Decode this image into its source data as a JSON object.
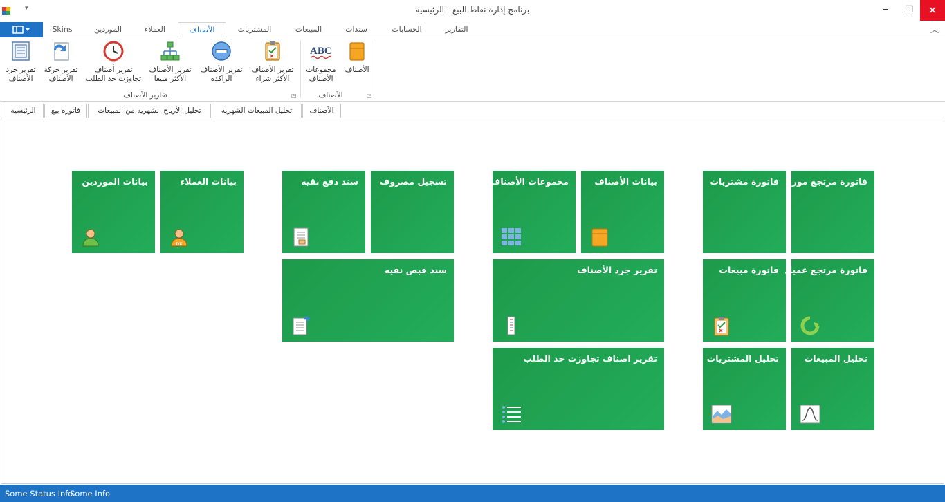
{
  "window": {
    "title": "برنامج إدارة نقاط البيع - الرئيسيه",
    "qat_symbol": "▾",
    "min_symbol": "─",
    "restore_symbol": "❐",
    "close_symbol": "✕"
  },
  "ribbon_tabs": [
    "Skins",
    "الموردين",
    "العملاء",
    "الأصناف",
    "المشتريات",
    "المبيعات",
    "سندات",
    "الحسابات",
    "التقارير"
  ],
  "ribbon_tab_active": "الأصناف",
  "ribbon": {
    "buttons": [
      {
        "label": "تقرير جرد\nالأصناف",
        "icon": "inventory-report-icon"
      },
      {
        "label": "تقرير حركة\nالأصناف",
        "icon": "movement-report-icon"
      },
      {
        "label": "تقرير أصناف\nتجاوزت حد الطلب",
        "icon": "clock-icon"
      },
      {
        "label": "تقرير الأصناف\nالأكثر مبيعا",
        "icon": "org-chart-icon"
      },
      {
        "label": "تقرير الأصناف\nالراكده",
        "icon": "minus-circle-icon"
      },
      {
        "label": "تقرير الأصناف\nالأكثر شراء",
        "icon": "clipboard-icon"
      },
      {
        "label": "مجموعات\nالأصناف",
        "icon": "abc-icon"
      },
      {
        "label": "الأصناف",
        "icon": "box-icon"
      }
    ],
    "groups": [
      "تقارير الأصناف",
      "الأصناف"
    ],
    "launcher_symbol": "◳"
  },
  "doc_tabs": [
    "الرئيسيه",
    "فاتورة بيع",
    "تحليل الأرباح الشهريه من المبيعات",
    "تحليل المبيعات الشهريه",
    "الأصناف"
  ],
  "tiles": [
    {
      "title": "بيانات الموردين",
      "icon": "user-icon"
    },
    {
      "title": "بيانات العملاء",
      "icon": "user-dx-icon"
    },
    {
      "title": "سند دفع نقيه",
      "icon": "document-icon"
    },
    {
      "title": "تسجيل مصروف",
      "icon": ""
    },
    {
      "title": "سند قبض نقيه",
      "icon": "document-add-icon"
    },
    {
      "title": "مجموعات الأصناف",
      "icon": "grid-icon"
    },
    {
      "title": "بيانات الأصناف",
      "icon": "box-icon"
    },
    {
      "title": "تقرير جرد الأصناف",
      "icon": "ruler-icon"
    },
    {
      "title": "تقرير اصناف تجاوزت حد الطلب",
      "icon": "list-icon"
    },
    {
      "title": "فاتورة مشتريات",
      "icon": ""
    },
    {
      "title": "فاتورة مرتجع مورد",
      "icon": ""
    },
    {
      "title": "فاتورة مبيعات",
      "icon": "clipboard-icon"
    },
    {
      "title": "فاتورة مرتجع عميل",
      "icon": "refresh-icon"
    },
    {
      "title": "تحليل المشتريات",
      "icon": "area-chart-icon"
    },
    {
      "title": "تحليل المبيعات",
      "icon": "curve-icon"
    }
  ],
  "status": [
    "Some Status Info",
    "Some Info"
  ],
  "colors": {
    "accent": "#1e73c7",
    "tile": "#1e9a4b",
    "close": "#e81123"
  }
}
